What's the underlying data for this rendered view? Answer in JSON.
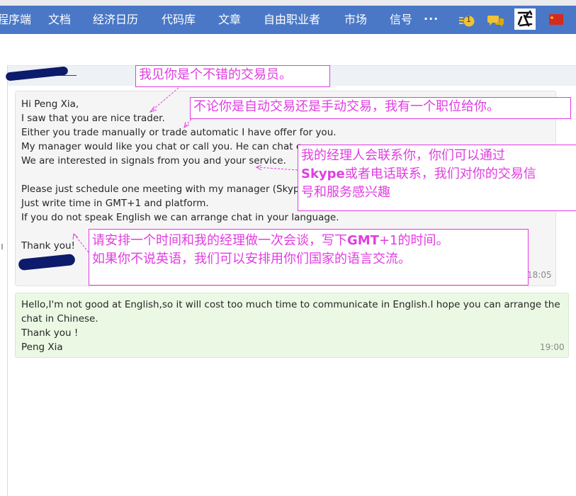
{
  "nav": {
    "items": [
      "程序端",
      "文档",
      "经济日历",
      "代码库",
      "文章",
      "自由职业者",
      "市场",
      "信号"
    ],
    "more": "···",
    "notification_count": "1"
  },
  "thread": {
    "incoming": {
      "lines": [
        "Hi Peng Xia,",
        "I saw that you are nice trader.",
        "Either you trade manually or trade automatic I have offer for you.",
        "My manager would like you chat or call you. He can chat c",
        "We are interested in signals from you and your service.",
        "",
        "Please just schedule one meeting with my manager (Skype",
        "Just write time in GMT+1 and platform.",
        "If you do not speak English we can arrange chat in your language.",
        "",
        "Thank you!"
      ],
      "time": "18:05"
    },
    "outgoing": {
      "lines": [
        "Hello,I'm not good at English,so it will cost too much time to communicate in English.I hope you can arrange the",
        "chat in Chinese.",
        "Thank you !",
        "Peng Xia"
      ],
      "time": "19:00"
    }
  },
  "annotations": {
    "a1": "我见你是个不错的交易员。",
    "a2": "不论你是自动交易还是手动交易，我有一个职位给你。",
    "a3_line1": "我的经理人会联系你，你们可以通过",
    "a3_skype": "Skype",
    "a3_line2_rest": "或者电话联系，我们对你的交易信",
    "a3_line3": "号和服务感兴趣",
    "a4_line1_pre": "请安排一个时间和我的经理做一次会谈，写下",
    "a4_gmt": "GMT",
    "a4_line1_post": "+1的时间。",
    "a4_line2": "如果你不说英语，我们可以安排用你们国家的语言交流。"
  },
  "colors": {
    "nav_bg": "#4a78c6",
    "annotation": "#e03ee0",
    "incoming_bg": "#f5f5f5",
    "outgoing_bg": "#ebf9e4"
  }
}
